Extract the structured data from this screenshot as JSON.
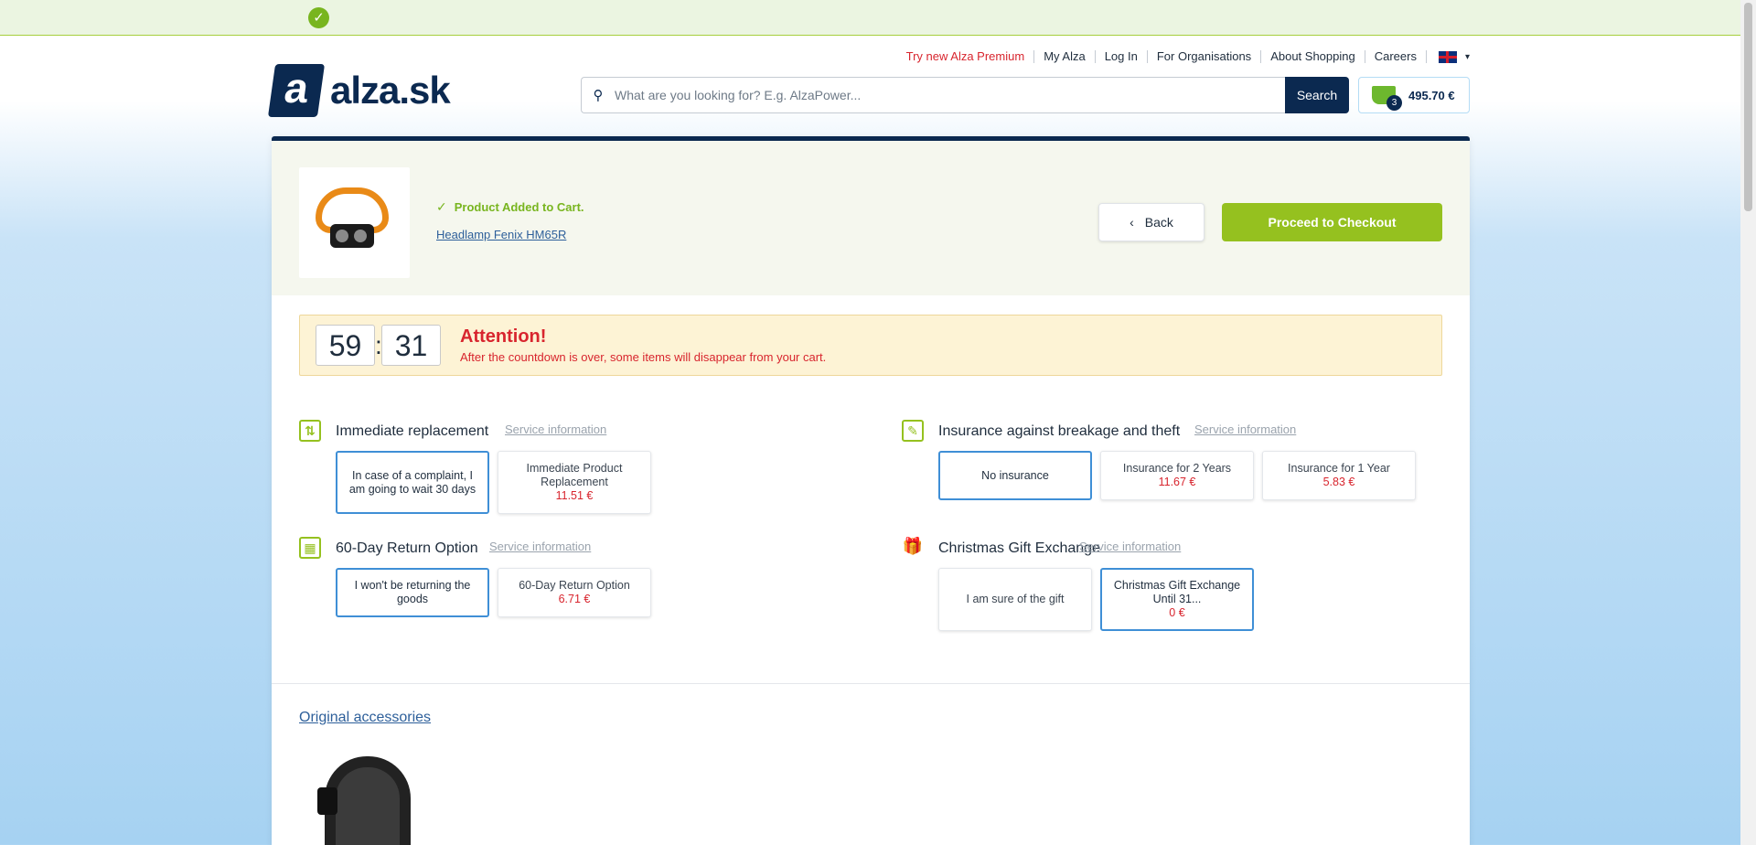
{
  "header": {
    "top_links": [
      "Try new Alza Premium",
      "My Alza",
      "Log In",
      "For Organisations",
      "About Shopping",
      "Careers"
    ],
    "logo_text": "alza.sk",
    "logo_mark": "a",
    "search_placeholder": "What are you looking for? E.g. AlzaPower...",
    "search_button": "Search",
    "cart_count": "3",
    "cart_total": "495.70 €"
  },
  "added": {
    "status": "Product Added to Cart.",
    "product_name": "Headlamp Fenix HM65R",
    "back_label": "Back",
    "checkout_label": "Proceed to Checkout"
  },
  "timer": {
    "minutes": "59",
    "seconds": "31",
    "attention": "Attention!",
    "message": "After the countdown is over, some items will disappear from your cart."
  },
  "services": {
    "replacement": {
      "title": "Immediate replacement",
      "info": "Service information",
      "options": [
        {
          "label": "In case of a complaint, I am going to wait 30 days",
          "price": "",
          "selected": true
        },
        {
          "label": "Immediate Product Replacement",
          "price": "11.51 €",
          "selected": false
        }
      ]
    },
    "insurance": {
      "title": "Insurance against breakage and theft",
      "info": "Service information",
      "options": [
        {
          "label": "No insurance",
          "price": "",
          "selected": true
        },
        {
          "label": "Insurance for 2 Years",
          "price": "11.67 €",
          "selected": false
        },
        {
          "label": "Insurance for 1 Year",
          "price": "5.83 €",
          "selected": false
        }
      ]
    },
    "return": {
      "title": "60-Day Return Option",
      "info": "Service information",
      "options": [
        {
          "label": "I won't be returning the goods",
          "price": "",
          "selected": true
        },
        {
          "label": "60-Day Return Option",
          "price": "6.71 €",
          "selected": false
        }
      ]
    },
    "gift": {
      "title": "Christmas Gift Exchange",
      "info": "Service information",
      "options": [
        {
          "label": "I am sure of the gift",
          "price": "",
          "selected": false
        },
        {
          "label": "Christmas Gift Exchange Until 31...",
          "price": "0 €",
          "selected": true
        }
      ]
    }
  },
  "accessories": {
    "title": "Original accessories"
  },
  "colors": {
    "brand_navy": "#0b2950",
    "accent_green": "#95c11f",
    "price_red": "#d8252e",
    "selected_blue": "#3f8fd6"
  }
}
